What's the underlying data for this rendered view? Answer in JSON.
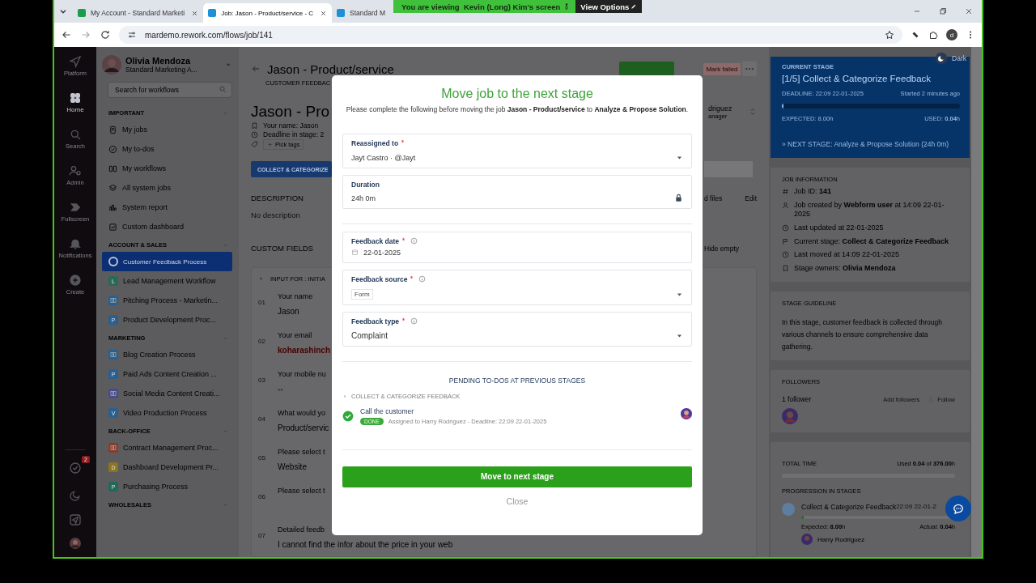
{
  "browser": {
    "tabs": [
      {
        "title": "My Account - Standard Marketi",
        "selected": false,
        "color": "#1a9c4a"
      },
      {
        "title": "Job: Jason - Product/service - C",
        "selected": true,
        "color": "#1e90d8"
      },
      {
        "title": "Standard M",
        "selected": false,
        "color": "#1e90d8"
      }
    ],
    "url": "mardemo.rework.com/flows/job/141",
    "profile_initial": "d"
  },
  "share_banner": {
    "text": "You are viewing  Kevin (Long) Kim's screen",
    "button": "View Options"
  },
  "rail": {
    "items": [
      {
        "label": "Platform",
        "selected": false
      },
      {
        "label": "Home",
        "selected": true
      },
      {
        "label": "Search",
        "selected": false
      },
      {
        "label": "Admin",
        "selected": false
      },
      {
        "label": "Fullscreen",
        "selected": false
      },
      {
        "label": "Notifications",
        "selected": false
      },
      {
        "label": "Create",
        "selected": false
      }
    ],
    "todo_badge": "2"
  },
  "sidebar": {
    "user": {
      "name": "Olivia Mendoza",
      "org": "Standard Marketing A..."
    },
    "search": {
      "placeholder": "Search for workflows"
    },
    "important": {
      "title": "IMPORTANT",
      "items": [
        "My jobs",
        "My to-dos",
        "My workflows",
        "All system jobs",
        "System report",
        "Custom dashboard"
      ]
    },
    "groups": [
      {
        "title": "ACCOUNT & SALES",
        "items": [
          {
            "label": "Customer Feedback Process",
            "kind": "ring",
            "color": "#b8c2da",
            "selected": true
          },
          {
            "label": "Lead Management Workflow",
            "kind": "letter",
            "letter": "L",
            "color": "#2a6a55",
            "selected": false
          },
          {
            "label": "Pitching Process - Marketin...",
            "kind": "board",
            "color": "#2a5f92",
            "selected": false
          },
          {
            "label": "Product Development Proc...",
            "kind": "letter",
            "letter": "P",
            "color": "#2a5f92",
            "selected": false
          }
        ]
      },
      {
        "title": "MARKETING",
        "items": [
          {
            "label": "Blog Creation Process",
            "kind": "board",
            "color": "#2a5f92",
            "selected": false
          },
          {
            "label": "Paid Ads Content Creation ...",
            "kind": "letter",
            "letter": "P",
            "color": "#2a5f92",
            "selected": false
          },
          {
            "label": "Social Media Content Creati...",
            "kind": "board",
            "color": "#4a4a8c",
            "selected": false
          },
          {
            "label": "Video Production Process",
            "kind": "letter",
            "letter": "V",
            "color": "#2a5f92",
            "selected": false
          }
        ]
      },
      {
        "title": "BACK-OFFICE",
        "items": [
          {
            "label": "Contract Management Proc...",
            "kind": "board",
            "color": "#8c3a28",
            "selected": false
          },
          {
            "label": "Dashboard Development Pr...",
            "kind": "letter",
            "letter": "D",
            "color": "#8a7420",
            "selected": false
          },
          {
            "label": "Purchasing Process",
            "kind": "letter",
            "letter": "P",
            "color": "#23695a",
            "selected": false
          }
        ]
      },
      {
        "title": "WHOLESALES"
      }
    ]
  },
  "job": {
    "title": "Jason - Product/service",
    "subtitle": "CUSTOMER FEEDBAC",
    "heading": "Jason - Pro",
    "mark_failed": "Mark failed",
    "assignee": {
      "name": "driguez",
      "role": "anager"
    },
    "meta": [
      "Your name: Jason",
      "Deadline in stage: 2"
    ],
    "pick_tags": "Pick tags",
    "stage_bar": "COLLECT & CATEGORIZE",
    "description": {
      "title": "DESCRIPTION",
      "text": "No description",
      "files": "d files",
      "edit": "Edit"
    },
    "custom_fields": {
      "title": "CUSTOM FIELDS",
      "hide": "Hide empty",
      "section": "INPUT FOR : INITIA",
      "rows": [
        {
          "number": "01",
          "label": "Your name",
          "kind": "text",
          "value": "Jason"
        },
        {
          "number": "02",
          "label": "Your email",
          "kind": "email",
          "value": "koharashinch"
        },
        {
          "number": "03",
          "label": "Your mobile nu",
          "kind": "text",
          "value": "--"
        },
        {
          "number": "04",
          "label": "What would yo",
          "kind": "text",
          "value": "Product/servic"
        },
        {
          "number": "05",
          "label": "Please select t",
          "kind": "text",
          "value": "Website"
        },
        {
          "number": "06",
          "label": "Please select t"
        },
        {
          "number": "07",
          "label": "Detailed feedb",
          "kind": "text",
          "value": "I cannot find the infor about the price in your web"
        }
      ]
    }
  },
  "right_panel": {
    "dark_toggle": "Dark",
    "current_stage": {
      "label": "CURRENT STAGE",
      "title": "[1/5] Collect & Categorize Feedback",
      "deadline": "DEADLINE: 22:09 22-01-2025",
      "started": "Started 2 minutes ago",
      "level": 0.01,
      "expected": "EXPECTED: 8.00h",
      "used": "USED: **0.04**h",
      "next": "» NEXT STAGE: Analyze & Propose Solution (24h 0m)"
    },
    "job_information": {
      "title": "JOB INFORMATION",
      "rows": [
        "Job ID: **141**",
        "Job created by **Webform user** at 14:09 22-01-2025",
        "Last updated at 22-01-2025",
        "Current stage: **Collect & Categorize Feedback**",
        "Last moved at 14:09 22-01-2025",
        "Stage owners: **Olivia Mendoza**"
      ]
    },
    "stage_guideline": {
      "title": "STAGE GUIDELINE",
      "text": "In this stage, customer feedback is collected through various channels to ensure comprehensive data gathering."
    },
    "followers": {
      "title": "FOLLOWERS",
      "count": "1 follower",
      "add": "Add followers",
      "follow": "Follow"
    },
    "total_time": {
      "title": "TOTAL TIME",
      "used": "Used **0.04** of **376.00**h",
      "level": 0,
      "progression_title": "PROGRESSION IN STAGES",
      "stages": [
        {
          "name": "Collect & Categorize Feedback",
          "date": "22:09 22-01-2",
          "level": 0.01,
          "expected": "Expected: **8.00**h",
          "actual": "Actual: **0.04**h",
          "owner": "Harry Rodriguez"
        }
      ]
    }
  },
  "modal": {
    "title": "Move job to the next stage",
    "intro": "Please complete the following before moving the job **Jason - Product/service** to **Analyze & Propose Solution**.",
    "assignment_fields": [
      {
        "kind": "select",
        "label": "Reassigned to",
        "required": true,
        "info": false,
        "value": "Jayt Castro · @Jayt"
      },
      {
        "kind": "locked",
        "label": "Duration",
        "required": false,
        "info": false,
        "value": "24h 0m"
      }
    ],
    "stage_fields": [
      {
        "kind": "date",
        "label": "Feedback date",
        "required": true,
        "info": true,
        "value": "22-01-2025"
      },
      {
        "kind": "tags",
        "label": "Feedback source",
        "required": true,
        "info": true,
        "value": "Form"
      },
      {
        "kind": "select",
        "label": "Feedback type",
        "required": true,
        "info": true,
        "value": "Complaint"
      }
    ],
    "pending": {
      "title": "PENDING TO-DOS AT PREVIOUS STAGES",
      "group": "COLLECT & CATEGORIZE FEEDBACK",
      "todos": [
        {
          "title": "Call the customer",
          "done": true,
          "status": "DONE",
          "detail": "Assigned to Harry Rodriguez - Deadline: 22:09 22-01-2025"
        }
      ]
    },
    "primary": "Move to next stage",
    "close": "Close"
  }
}
